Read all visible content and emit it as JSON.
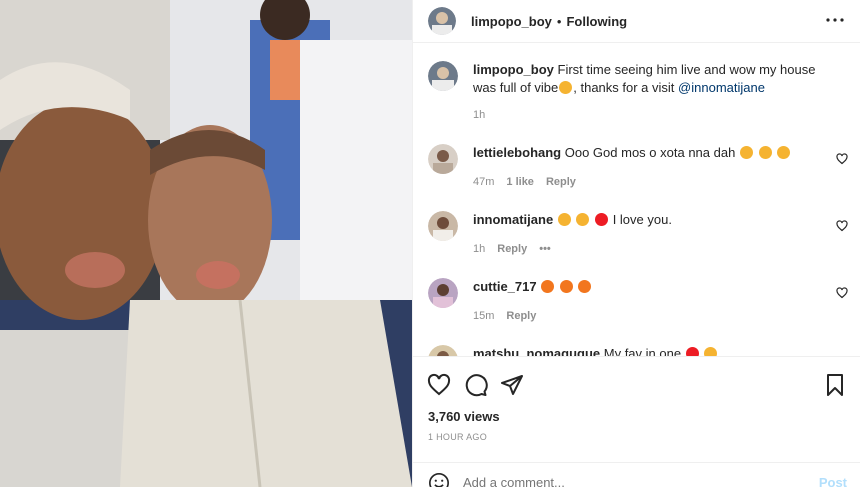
{
  "post": {
    "username": "limpopo_boy",
    "separator": "•",
    "follow_status": "Following",
    "more_icon": "more-horizontal-icon"
  },
  "caption": {
    "username": "limpopo_boy",
    "text": "First time seeing him live and wow my house was full of vibe",
    "text2": ", thanks for a visit",
    "mention": "@innomatijane",
    "time": "1h"
  },
  "comments": [
    {
      "username": "lettielebohang",
      "text": "Ooo God mos o xota nna dah",
      "time": "47m",
      "likes": "1 like",
      "reply": "Reply"
    },
    {
      "username": "innomatijane",
      "text": "I love you.",
      "time": "1h",
      "reply": "Reply",
      "more": "•••"
    },
    {
      "username": "cuttie_717",
      "text": "",
      "time": "15m",
      "reply": "Reply"
    },
    {
      "username": "matshu_nomaguque",
      "text": "My fav in one"
    }
  ],
  "stats": {
    "views": "3,760 views",
    "posted": "1 HOUR AGO"
  },
  "add_comment": {
    "placeholder": "Add a comment...",
    "post_label": "Post"
  },
  "colors": {
    "link": "#00376b",
    "muted": "#8e8e8e",
    "post_disabled": "#b2dffc",
    "heart_red": "#ed1c24"
  }
}
